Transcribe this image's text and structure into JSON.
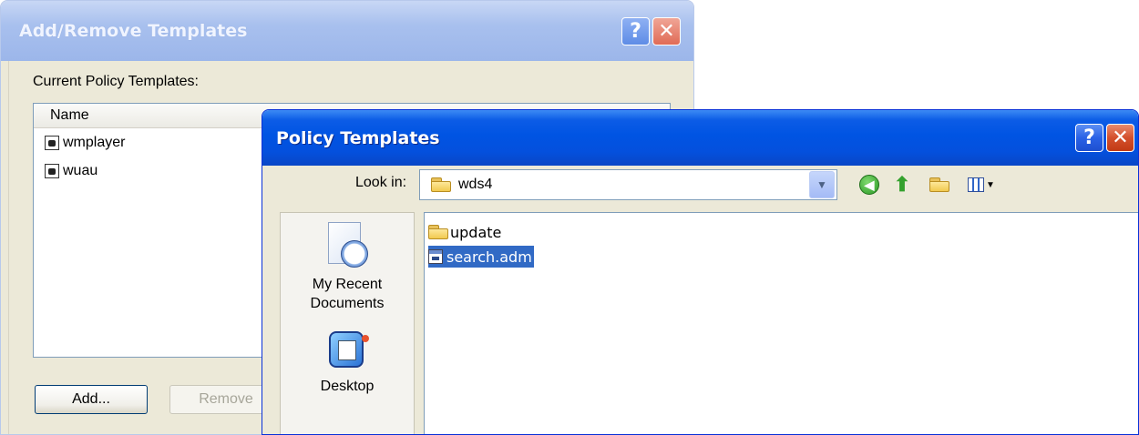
{
  "addremove": {
    "title": "Add/Remove Templates",
    "current_label": "Current Policy Templates:",
    "column_name": "Name",
    "templates": [
      "wmplayer",
      "wuau"
    ],
    "add_button": "Add...",
    "remove_button": "Remove",
    "help_glyph": "?",
    "close_glyph": "✕"
  },
  "policy": {
    "title": "Policy Templates",
    "lookin_label": "Look in:",
    "lookin_value": "wds4",
    "toolbar_icons": [
      "back-icon",
      "up-folder-icon",
      "new-folder-icon",
      "views-menu-icon"
    ],
    "places": {
      "recent": "My Recent Documents",
      "desktop": "Desktop"
    },
    "files": [
      {
        "name": "update",
        "type": "folder",
        "selected": false
      },
      {
        "name": "search.adm",
        "type": "adm",
        "selected": true
      }
    ],
    "help_glyph": "?",
    "close_glyph": "✕"
  },
  "colors": {
    "xp_blue": "#0054e3",
    "dialog_bg": "#ece9d8",
    "selection": "#316ac5"
  }
}
